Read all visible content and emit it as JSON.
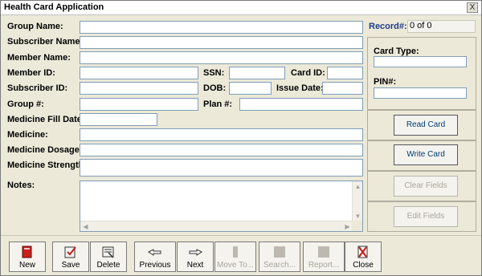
{
  "window": {
    "title": "Health Card Application",
    "close_glyph": "X"
  },
  "labels": {
    "group_name": "Group Name:",
    "subscriber_name": "Subscriber Name:",
    "member_name": "Member Name:",
    "member_id": "Member ID:",
    "ssn": "SSN:",
    "card_id": "Card ID:",
    "subscriber_id": "Subscriber ID:",
    "dob": "DOB:",
    "issue_date": "Issue Date:",
    "group_num": "Group #:",
    "plan_num": "Plan #:",
    "medicine_fill_date": "Medicine Fill Date:",
    "medicine": "Medicine:",
    "medicine_dosage": "Medicine Dosage:",
    "medicine_strength": "Medicine Strength:",
    "notes": "Notes:"
  },
  "record": {
    "label": "Record#:",
    "value": "0 of 0"
  },
  "card_panel": {
    "card_type_label": "Card Type:",
    "pin_label": "PIN#:"
  },
  "side_buttons": [
    {
      "label": "Read Card",
      "enabled": true
    },
    {
      "label": "Write Card",
      "enabled": true
    },
    {
      "label": "Clear Fields",
      "enabled": false
    },
    {
      "label": "Edit Fields",
      "enabled": false
    }
  ],
  "toolbar": [
    {
      "label": "New",
      "icon": "book-icon",
      "enabled": true
    },
    {
      "label": "Save",
      "icon": "save-icon",
      "enabled": true
    },
    {
      "label": "Delete",
      "icon": "delete-icon",
      "enabled": true
    },
    {
      "label": "Previous",
      "icon": "hand-left-icon",
      "enabled": true
    },
    {
      "label": "Next",
      "icon": "hand-right-icon",
      "enabled": true
    },
    {
      "label": "Move To...",
      "icon": "move-to-icon",
      "enabled": false
    },
    {
      "label": "Search...",
      "icon": "search-icon",
      "enabled": false
    },
    {
      "label": "Report...",
      "icon": "report-icon",
      "enabled": false
    },
    {
      "label": "Close",
      "icon": "close-icon",
      "enabled": true
    }
  ],
  "colors": {
    "record_label": "#1c3e8c",
    "accent_button_text": "#003c74",
    "disabled_text": "#a8a59a"
  }
}
